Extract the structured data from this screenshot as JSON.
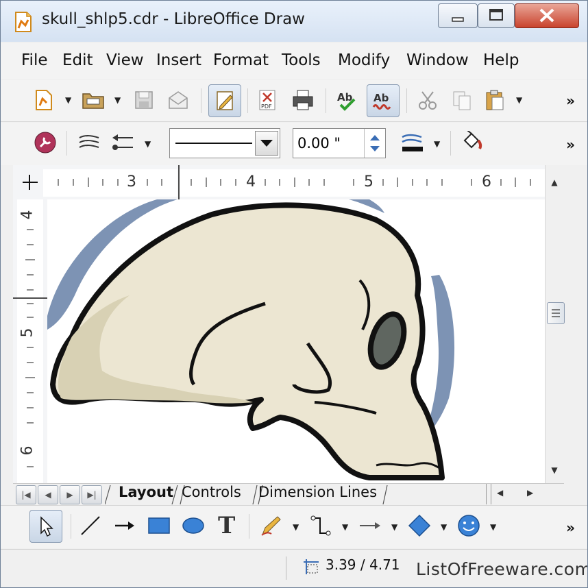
{
  "window": {
    "title": "skull_shlp5.cdr - LibreOffice Draw",
    "minimize_glyph": "▭",
    "maximize_glyph": "▢",
    "close_glyph": "✕"
  },
  "menu": {
    "items": [
      "File",
      "Edit",
      "View",
      "Insert",
      "Format",
      "Tools",
      "Modify",
      "Window",
      "Help"
    ]
  },
  "toolbar_standard": {
    "icons": [
      "new-document-icon",
      "open-folder-icon",
      "save-icon",
      "email-icon",
      "edit-file-icon",
      "export-pdf-icon",
      "print-icon",
      "spellcheck-icon",
      "autospellcheck-icon",
      "cut-icon",
      "copy-icon",
      "paste-icon"
    ],
    "more_glyph": "»"
  },
  "toolbar_line": {
    "line_width_value": "0.00 \"",
    "more_glyph": "»"
  },
  "ruler": {
    "horizontal_labels": [
      "3",
      "4",
      "5",
      "6"
    ],
    "vertical_labels": [
      "4",
      "5",
      "6"
    ]
  },
  "tabs": {
    "items": [
      "Layout",
      "Controls",
      "Dimension Lines"
    ],
    "active": "Layout"
  },
  "status": {
    "position": "3.39 / 4.71",
    "watermark": "ListOfFreeware.com"
  },
  "colors": {
    "skull_fill": "#ece6d2",
    "skull_shade": "#d8d1b4",
    "halo": "#7d93b4",
    "accent_red": "#c0392b"
  }
}
